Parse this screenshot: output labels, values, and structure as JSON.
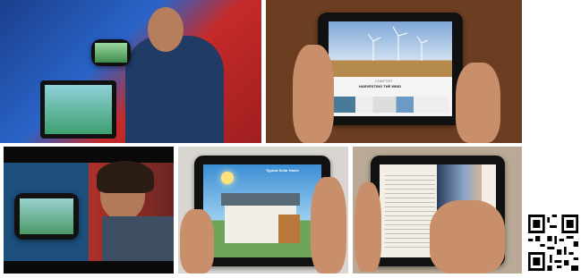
{
  "photos": [
    {
      "subject": "presenter holding tablet on stage with large screen showing game"
    },
    {
      "subject": "hands holding tablet showing wind turbines article"
    },
    {
      "subject": "presenter holding tablet showing game on stage"
    },
    {
      "subject": "hands holding tablet showing solar house infographic"
    },
    {
      "subject": "hand turning page of ebook on tablet"
    }
  ],
  "article": {
    "kicker": "CHAPTER",
    "title": "HARVESTING THE WIND"
  },
  "infographic": {
    "title": "Typical Solar Home"
  },
  "qr_code": {
    "label": "QR code"
  }
}
